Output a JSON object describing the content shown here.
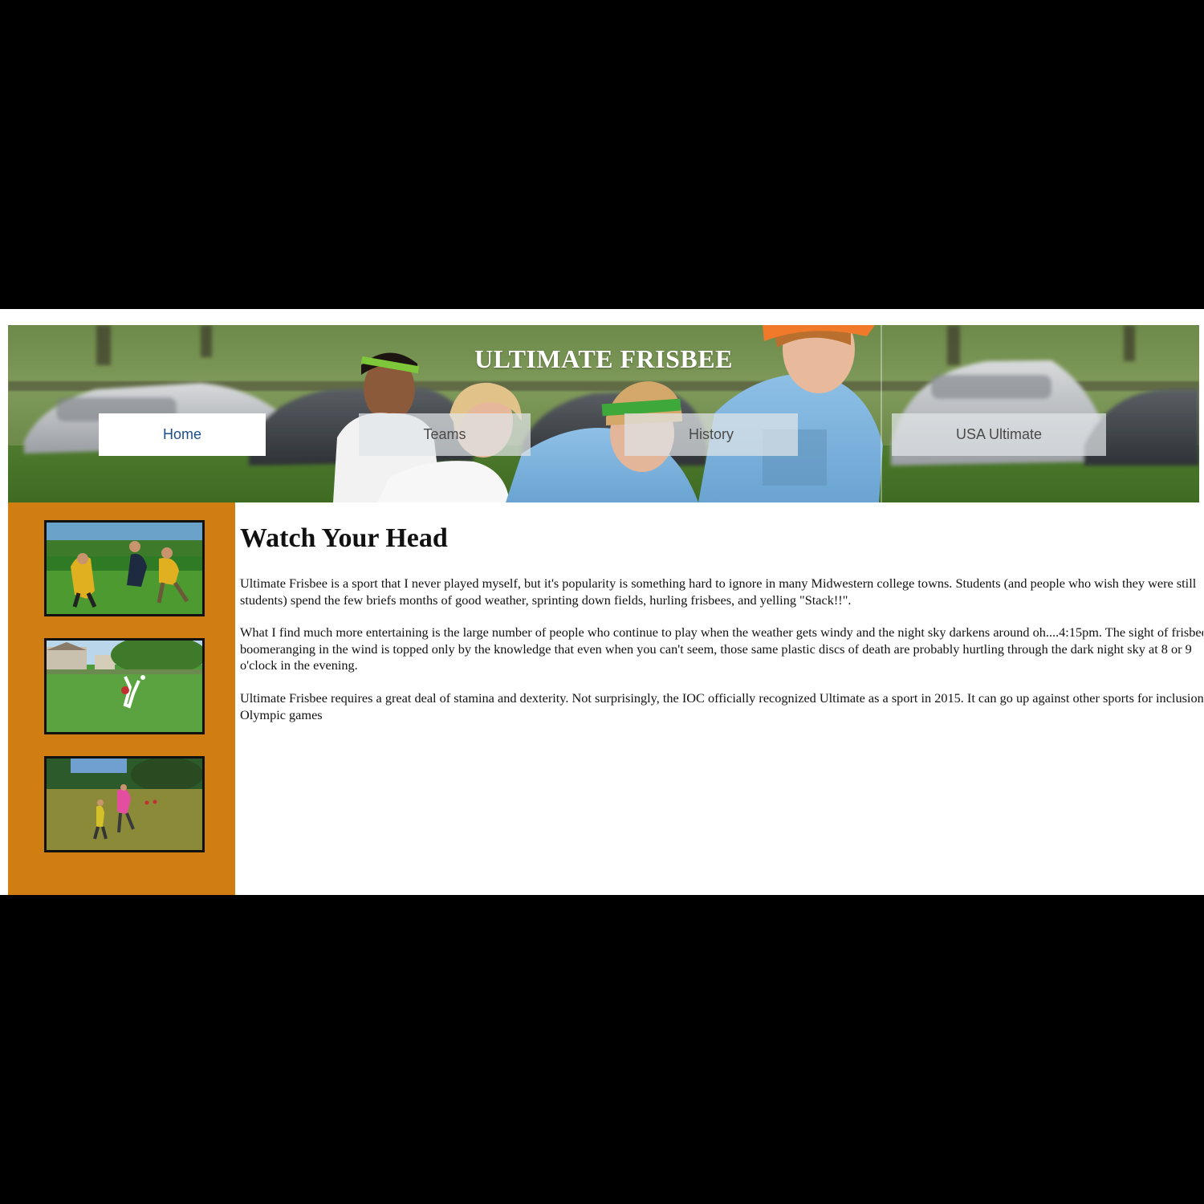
{
  "header": {
    "site_title": "ULTIMATE FRISBEE"
  },
  "nav": {
    "items": [
      {
        "label": "Home",
        "active": true
      },
      {
        "label": "Teams",
        "active": false
      },
      {
        "label": "History",
        "active": false
      },
      {
        "label": "USA Ultimate",
        "active": false
      }
    ]
  },
  "main": {
    "title": "Watch Your Head",
    "paragraphs": [
      "Ultimate Frisbee is a sport that I never played myself, but it's popularity is something hard to ignore in many Midwestern college towns. Students (and people who wish they were still students) spend the few briefs months of good weather, sprinting down fields, hurling frisbees, and yelling \"Stack!!\".",
      "What I find much more entertaining is the large number of people who continue to play when the weather gets windy and the night sky darkens around oh....4:15pm. The sight of frisbees boomeranging in the wind is topped only by the knowledge that even when you can't seem, those same plastic discs of death are probably hurtling through the dark night sky at 8 or 9 o'clock in the evening.",
      "Ultimate Frisbee requires a great deal of stamina and dexterity. Not surprisingly, the IOC officially recognized Ultimate as a sport in 2015. It can go up against other sports for inclusion in Olympic games"
    ]
  },
  "colors": {
    "sidebar": "#d07d12",
    "page_bg": "#000000",
    "active_nav_text": "#1f4e8c"
  }
}
